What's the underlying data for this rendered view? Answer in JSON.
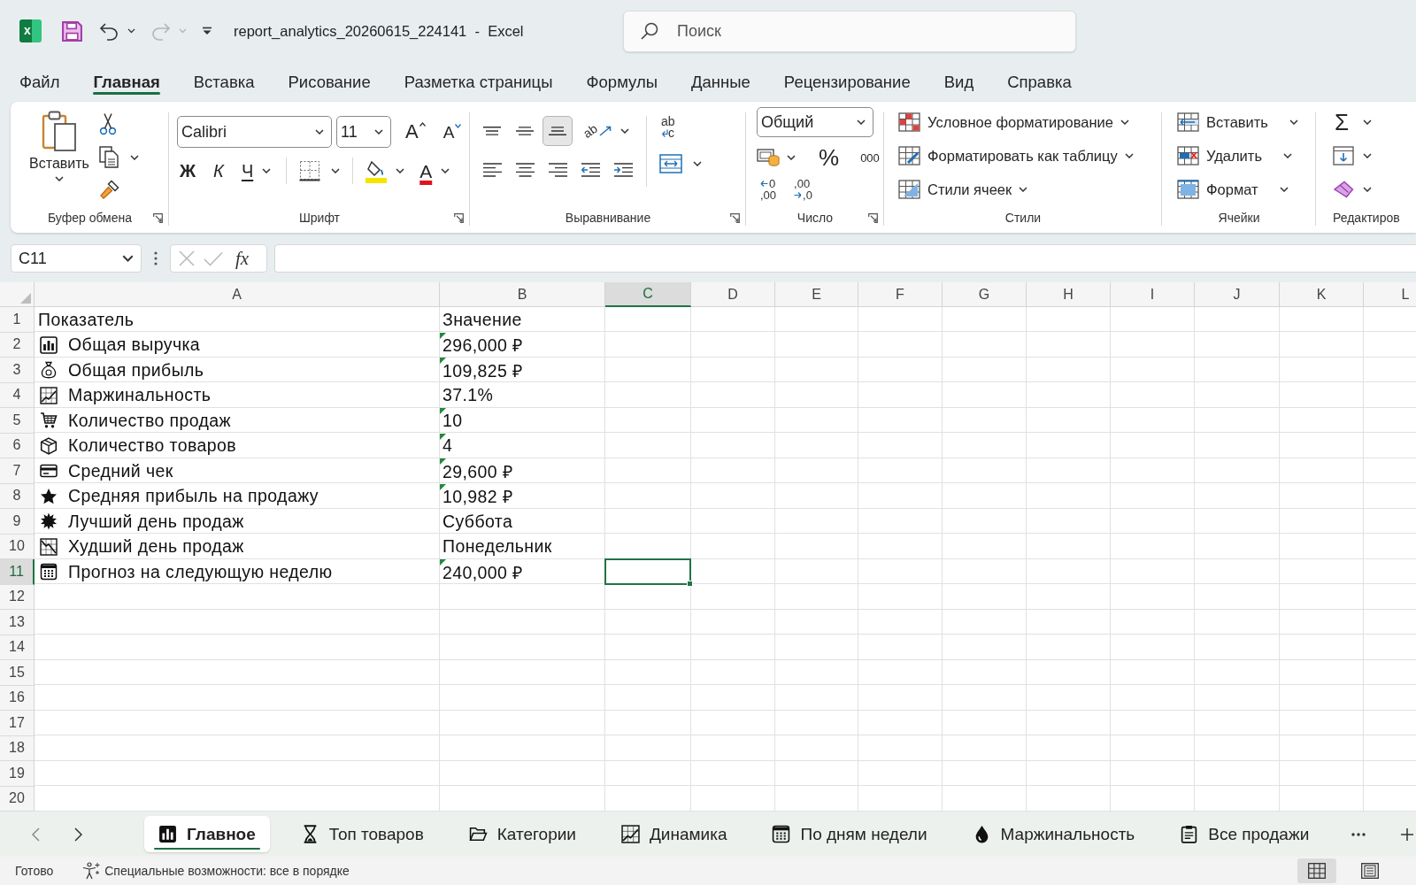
{
  "title_bar": {
    "app_logo": "x",
    "quick_access": [
      {
        "kind": "save",
        "disabled": false
      },
      {
        "kind": "undo",
        "disabled": false
      },
      {
        "kind": "redo",
        "disabled": true
      },
      {
        "kind": "customize",
        "disabled": false
      }
    ],
    "title": "report_analytics_20260615_224141  -  Excel",
    "search": {
      "placeholder": "Поиск"
    }
  },
  "menu_tabs": [
    {
      "label": "Файл",
      "selected": false
    },
    {
      "label": "Главная",
      "selected": true
    },
    {
      "label": "Вставка",
      "selected": false
    },
    {
      "label": "Рисование",
      "selected": false
    },
    {
      "label": "Разметка страницы",
      "selected": false
    },
    {
      "label": "Формулы",
      "selected": false
    },
    {
      "label": "Данные",
      "selected": false
    },
    {
      "label": "Рецензирование",
      "selected": false
    },
    {
      "label": "Вид",
      "selected": false
    },
    {
      "label": "Справка",
      "selected": false
    }
  ],
  "ribbon": {
    "clipboard": {
      "label": "Буфер обмена",
      "paste": "Вставить",
      "dialog_launcher": true
    },
    "font": {
      "label": "Шрифт",
      "font_name": "Calibri",
      "font_size": "11",
      "grow": "A",
      "shrink": "A",
      "bold": "Ж",
      "italic": "К",
      "underline": "Ч",
      "font_color": "A",
      "dialog_launcher": true
    },
    "alignment": {
      "label": "Выравнивание",
      "vertical_align": [
        {
          "kind": "top",
          "selected": false
        },
        {
          "kind": "middle",
          "selected": false
        },
        {
          "kind": "bottom",
          "selected": true
        }
      ],
      "orientation": "ab",
      "wrap": [
        "ab",
        "c"
      ],
      "dialog_launcher": true
    },
    "number": {
      "label": "Число",
      "format": "Общий",
      "percent": "%",
      "thousands": "000",
      "increase_decimal": [
        "0",
        ",00"
      ],
      "decrease_decimal": [
        ",00",
        ",0"
      ],
      "dialog_launcher": true
    },
    "styles": {
      "label": "Стили",
      "commands": [
        {
          "kind": "conditional",
          "label": "Условное форматирование"
        },
        {
          "kind": "table",
          "label": "Форматировать как таблицу"
        },
        {
          "kind": "cell_styles",
          "label": "Стили ячеек"
        }
      ]
    },
    "cells": {
      "label": "Ячейки",
      "commands": [
        {
          "kind": "insert",
          "label": "Вставить"
        },
        {
          "kind": "delete",
          "label": "Удалить"
        },
        {
          "kind": "format",
          "label": "Формат"
        }
      ]
    },
    "editing": {
      "label": "Редактиров",
      "autosum": "Σ"
    }
  },
  "formula_bar": {
    "name_box": "C11",
    "insert_function": "fx"
  },
  "sheet": {
    "columns": [
      {
        "label": "A",
        "selected": false
      },
      {
        "label": "B",
        "selected": false
      },
      {
        "label": "C",
        "selected": true
      },
      {
        "label": "D",
        "selected": false
      },
      {
        "label": "E",
        "selected": false
      },
      {
        "label": "F",
        "selected": false
      },
      {
        "label": "G",
        "selected": false
      },
      {
        "label": "H",
        "selected": false
      },
      {
        "label": "I",
        "selected": false
      },
      {
        "label": "J",
        "selected": false
      },
      {
        "label": "K",
        "selected": false
      },
      {
        "label": "L",
        "selected": false
      }
    ],
    "rows": [
      {
        "number": "1",
        "selected": false,
        "cells": [
          {
            "text": "Показатель"
          },
          {
            "text": "Значение",
            "error_indicator": false
          }
        ]
      },
      {
        "number": "2",
        "selected": false,
        "cells": [
          {
            "text": "Общая выручка"
          },
          {
            "text": "296,000 ₽",
            "error_indicator": true
          }
        ]
      },
      {
        "number": "3",
        "selected": false,
        "cells": [
          {
            "text": "Общая прибыль"
          },
          {
            "text": "109,825 ₽",
            "error_indicator": true
          }
        ]
      },
      {
        "number": "4",
        "selected": false,
        "cells": [
          {
            "text": "Маржинальность"
          },
          {
            "text": "37.1%",
            "error_indicator": false
          }
        ]
      },
      {
        "number": "5",
        "selected": false,
        "cells": [
          {
            "text": "Количество продаж"
          },
          {
            "text": "10",
            "error_indicator": true
          }
        ]
      },
      {
        "number": "6",
        "selected": false,
        "cells": [
          {
            "text": "Количество товаров"
          },
          {
            "text": "4",
            "error_indicator": true
          }
        ]
      },
      {
        "number": "7",
        "selected": false,
        "cells": [
          {
            "text": "Средний чек"
          },
          {
            "text": "29,600 ₽",
            "error_indicator": true
          }
        ]
      },
      {
        "number": "8",
        "selected": false,
        "cells": [
          {
            "text": "Средняя прибыль на продажу"
          },
          {
            "text": "10,982 ₽",
            "error_indicator": true
          }
        ]
      },
      {
        "number": "9",
        "selected": false,
        "cells": [
          {
            "text": "Лучший день продаж"
          },
          {
            "text": "Суббота",
            "error_indicator": false
          }
        ]
      },
      {
        "number": "10",
        "selected": false,
        "cells": [
          {
            "text": "Худший день продаж"
          },
          {
            "text": "Понедельник",
            "error_indicator": false
          }
        ]
      },
      {
        "number": "11",
        "selected": true,
        "cells": [
          {
            "text": "Прогноз на следующую неделю"
          },
          {
            "text": "240,000 ₽",
            "error_indicator": true
          }
        ]
      },
      {
        "number": "12",
        "selected": false
      },
      {
        "number": "13",
        "selected": false
      },
      {
        "number": "14",
        "selected": false
      },
      {
        "number": "15",
        "selected": false
      },
      {
        "number": "16",
        "selected": false
      },
      {
        "number": "17",
        "selected": false
      },
      {
        "number": "18",
        "selected": false
      },
      {
        "number": "19",
        "selected": false
      },
      {
        "number": "20",
        "selected": false
      }
    ]
  },
  "sheet_tabs": [
    {
      "label": "Главное",
      "selected": true
    },
    {
      "label": "Топ товаров",
      "selected": false
    },
    {
      "label": "Категории",
      "selected": false
    },
    {
      "label": "Динамика",
      "selected": false
    },
    {
      "label": "По дням недели",
      "selected": false
    },
    {
      "label": "Маржинальность",
      "selected": false
    },
    {
      "label": "Все продажи",
      "selected": false
    }
  ],
  "status_bar": {
    "status": "Готово",
    "accessibility": "Специальные возможности: все в порядке",
    "views": [
      {
        "kind": "normal",
        "selected": true
      },
      {
        "kind": "page_layout",
        "selected": false
      }
    ]
  }
}
